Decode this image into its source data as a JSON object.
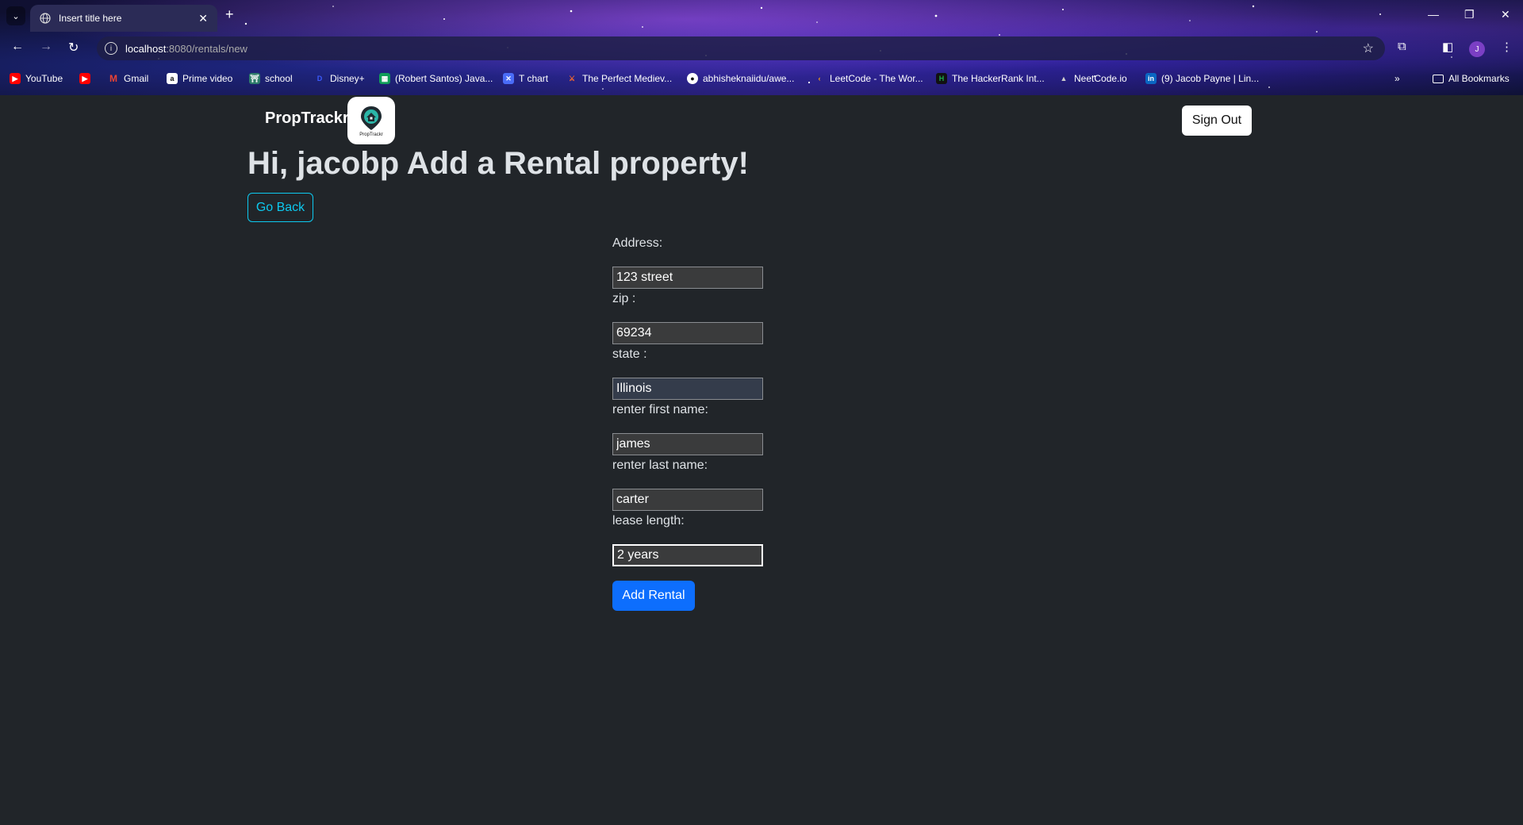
{
  "browser": {
    "tab_title": "Insert title here",
    "url_host": "localhost",
    "url_path": ":8080/rentals/new",
    "bookmarks": [
      {
        "label": "YouTube",
        "icon": "youtube-icon",
        "color": "#ff0000"
      },
      {
        "label": "",
        "icon": "youtube-icon",
        "color": "#ff0000"
      },
      {
        "label": "Gmail",
        "icon": "gmail-icon",
        "color": "#ea4335"
      },
      {
        "label": "Prime video",
        "icon": "amazon-icon",
        "color": "#ffffff"
      },
      {
        "label": "school",
        "icon": "school-icon",
        "color": "#2e7d6b"
      },
      {
        "label": "Disney+",
        "icon": "disney-icon",
        "color": "#1a3cff"
      },
      {
        "label": "(Robert Santos) Java...",
        "icon": "sheets-icon",
        "color": "#0f9d58"
      },
      {
        "label": "T chart",
        "icon": "tchart-icon",
        "color": "#4a6cf7"
      },
      {
        "label": "The Perfect Mediev...",
        "icon": "medieval-icon",
        "color": "#ff6a2a"
      },
      {
        "label": "abhisheknaiidu/awe...",
        "icon": "github-icon",
        "color": "#ffffff"
      },
      {
        "label": "LeetCode - The Wor...",
        "icon": "leetcode-icon",
        "color": "#ffa116"
      },
      {
        "label": "The HackerRank Int...",
        "icon": "hackerrank-icon",
        "color": "#1ba94c"
      },
      {
        "label": "NeetCode.io",
        "icon": "neetcode-icon",
        "color": "#cccccc"
      },
      {
        "label": "(9) Jacob Payne | Lin...",
        "icon": "linkedin-icon",
        "color": "#0a66c2"
      }
    ],
    "all_bookmarks": "All Bookmarks",
    "avatar_letter": "J"
  },
  "page": {
    "brand": "PropTrackr",
    "logo_text": "PropTrackr",
    "sign_out": "Sign Out",
    "greeting": "Hi, jacobp Add a Rental property!",
    "go_back": "Go Back"
  },
  "form": {
    "address_label": "Address:",
    "address_value": "123 street",
    "zip_label": "zip :",
    "zip_value": "69234",
    "state_label": "state :",
    "state_value": "Illinois",
    "first_name_label": "renter first name:",
    "first_name_value": "james",
    "last_name_label": "renter last name:",
    "last_name_value": "carter",
    "lease_label": "lease length:",
    "lease_value": "2 years",
    "submit": "Add Rental"
  },
  "colors": {
    "page_bg": "#212529",
    "primary": "#0d6efd",
    "info": "#0dcaf0"
  }
}
